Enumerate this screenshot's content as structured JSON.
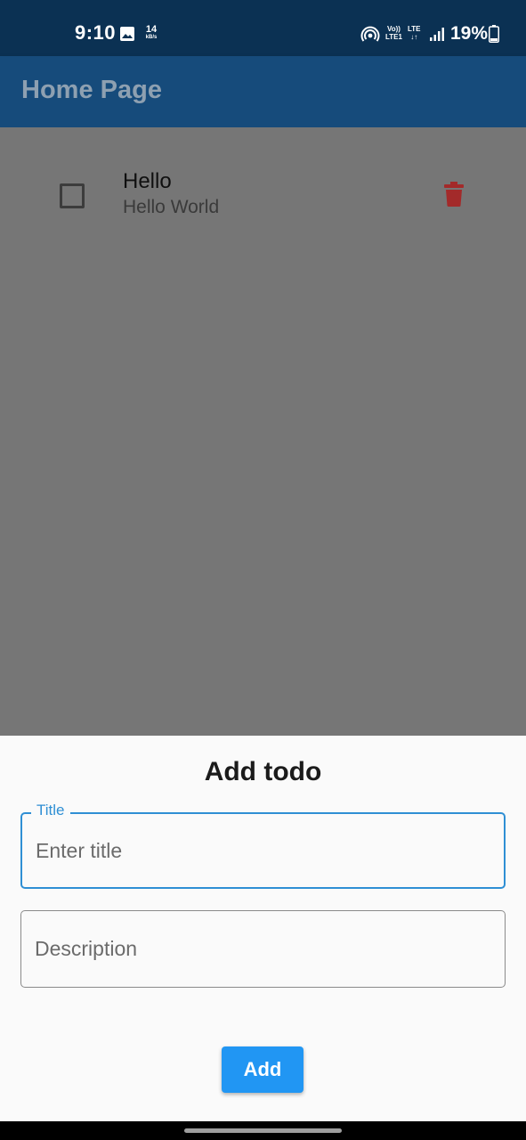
{
  "status_bar": {
    "time": "9:10",
    "speed_value": "14",
    "speed_unit": "kB/s",
    "volte_top": "Vo))",
    "volte_bottom": "LTE1",
    "lte_top": "LTE",
    "lte_bottom": "↓↑",
    "battery": "19%",
    "icons": [
      "gallery-icon",
      "hotspot-icon",
      "signal-icon",
      "battery-icon"
    ]
  },
  "app_bar": {
    "title": "Home Page",
    "color": "#164b7b"
  },
  "todos": [
    {
      "title": "Hello",
      "description": "Hello World",
      "checked": false,
      "delete_icon": "trash-icon",
      "delete_color": "#a32a2a"
    }
  ],
  "sheet": {
    "title": "Add todo",
    "title_field": {
      "label": "Title",
      "placeholder": "Enter title",
      "value": ""
    },
    "description_field": {
      "placeholder": "Description",
      "value": ""
    },
    "add_label": "Add",
    "accent": "#2196f3"
  }
}
